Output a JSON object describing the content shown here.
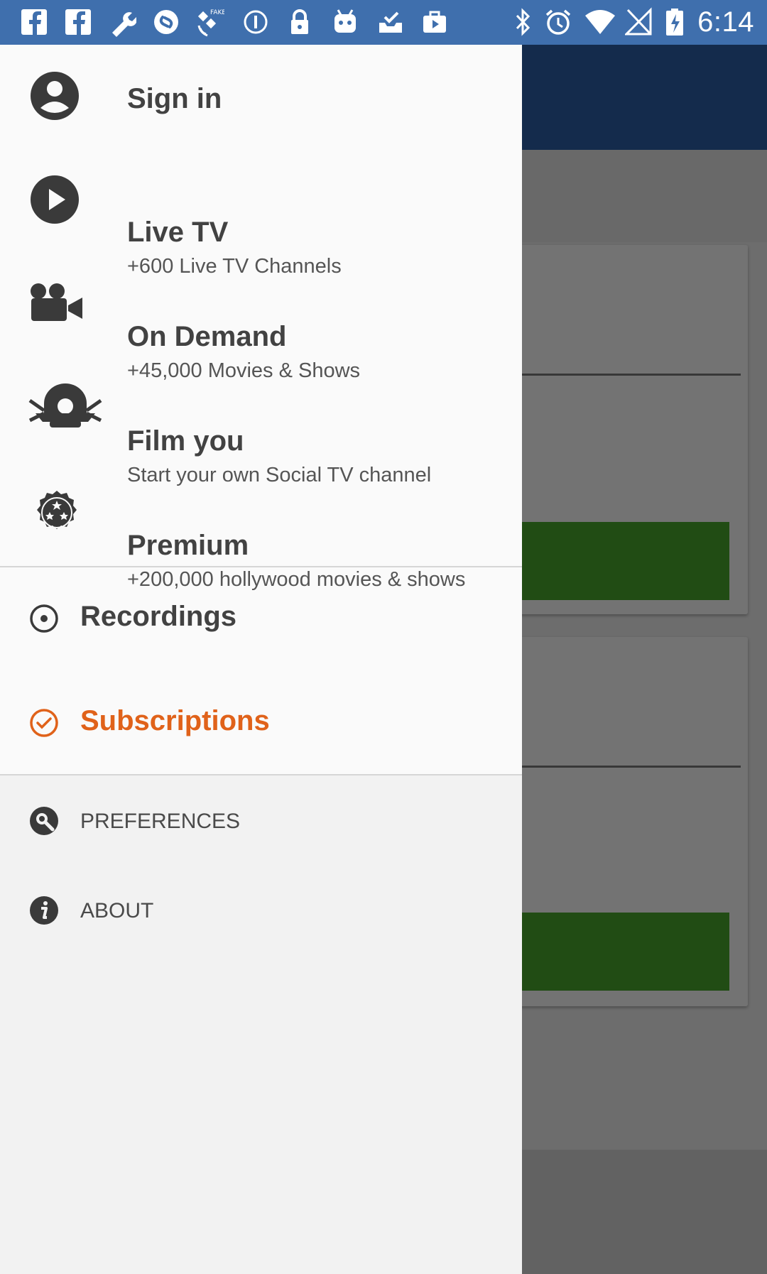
{
  "status_bar": {
    "time": "6:14",
    "colors": {
      "background": "#3f6fad"
    },
    "left_icons": [
      "facebook-icon",
      "facebook-icon",
      "wrench-icon",
      "shazam-icon",
      "satellite-icon",
      "info-circle-icon",
      "lock-icon",
      "android-icon",
      "inbox-check-icon",
      "briefcase-play-icon"
    ],
    "right_icons": [
      "bluetooth-icon",
      "alarm-icon",
      "wifi-icon",
      "signal-off-icon",
      "battery-charging-icon"
    ]
  },
  "drawer": {
    "sign_in": {
      "label": "Sign in",
      "icon": "account-circle-icon"
    },
    "primary_items": [
      {
        "title": "Live TV",
        "subtitle": "+600 Live TV Channels",
        "icon": "play-circle-icon"
      },
      {
        "title": "On Demand",
        "subtitle": "+45,000 Movies & Shows",
        "icon": "video-camera-icon"
      },
      {
        "title": "Film you",
        "subtitle": "Start your own Social TV channel",
        "icon": "film-you-icon"
      },
      {
        "title": "Premium",
        "subtitle": "+200,000 hollywood movies & shows",
        "icon": "premium-badge-icon"
      }
    ],
    "secondary_items": [
      {
        "label": "Recordings",
        "icon": "record-icon",
        "active": false
      },
      {
        "label": "Subscriptions",
        "icon": "check-circle-icon",
        "active": true
      }
    ],
    "settings_items": [
      {
        "label": "PREFERENCES",
        "icon": "preferences-icon"
      },
      {
        "label": "ABOUT",
        "icon": "info-icon"
      }
    ],
    "colors": {
      "active": "#e0621a",
      "text": "#424242",
      "icon": "#3a3a3a"
    }
  }
}
